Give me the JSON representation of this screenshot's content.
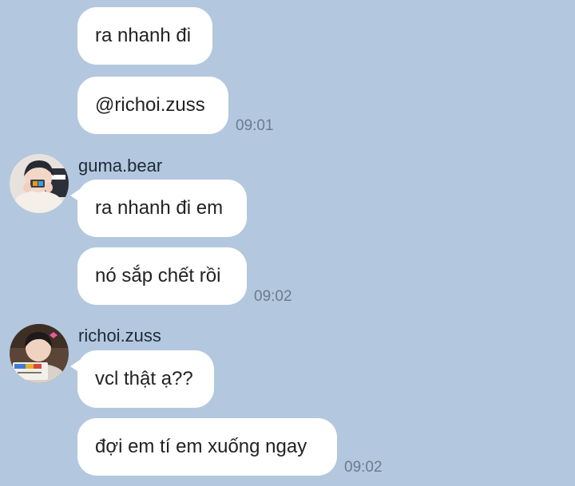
{
  "groups": [
    {
      "sender": "",
      "messages": [
        "ra nhanh đi",
        "@richoi.zuss"
      ],
      "time": "09:01"
    },
    {
      "sender": "guma.bear",
      "messages": [
        "ra nhanh đi em",
        "nó sắp chết rồi"
      ],
      "time": "09:02"
    },
    {
      "sender": "richoi.zuss",
      "messages": [
        "vcl thật ạ??",
        "đợi em tí em xuống ngay"
      ],
      "time": "09:02"
    }
  ],
  "colors": {
    "background": "#b3c8de",
    "bubble": "#ffffff",
    "text": "#222222",
    "time": "#6b7b8c"
  }
}
